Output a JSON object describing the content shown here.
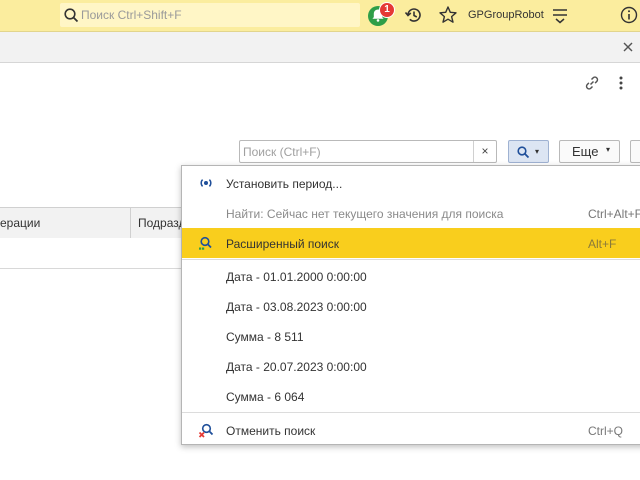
{
  "topbar": {
    "search_placeholder": "Поиск Ctrl+Shift+F",
    "notifications_count": "1",
    "user_name": "GPGroupRobot"
  },
  "form": {
    "search_placeholder": "Поиск (Ctrl+F)",
    "clear_label": "×",
    "more_label": "Еще",
    "caret": "▾"
  },
  "table": {
    "columns": [
      "ерации",
      "Подразд"
    ]
  },
  "menu": {
    "items": [
      {
        "label": "Установить период...",
        "shortcut": "",
        "icon": "period-icon"
      },
      {
        "label": "Найти: Сейчас нет текущего значения для поиска",
        "shortcut": "Ctrl+Alt+F",
        "icon": "",
        "disabled": true
      },
      {
        "label": "Расширенный поиск",
        "shortcut": "Alt+F",
        "icon": "advanced-search-icon",
        "highlight": true
      },
      {
        "label": "Дата - 01.01.2000 0:00:00",
        "shortcut": ""
      },
      {
        "label": "Дата - 03.08.2023 0:00:00",
        "shortcut": ""
      },
      {
        "label": "Сумма - 8 511",
        "shortcut": ""
      },
      {
        "label": "Дата - 20.07.2023 0:00:00",
        "shortcut": ""
      },
      {
        "label": "Сумма - 6 064",
        "shortcut": ""
      },
      {
        "label": "Отменить поиск",
        "shortcut": "Ctrl+Q",
        "icon": "cancel-search-icon"
      }
    ]
  },
  "colors": {
    "topbar_bg": "#fbed9e",
    "highlight": "#f9ce1d",
    "bell_green": "#2e9e48",
    "badge_red": "#e53935"
  }
}
